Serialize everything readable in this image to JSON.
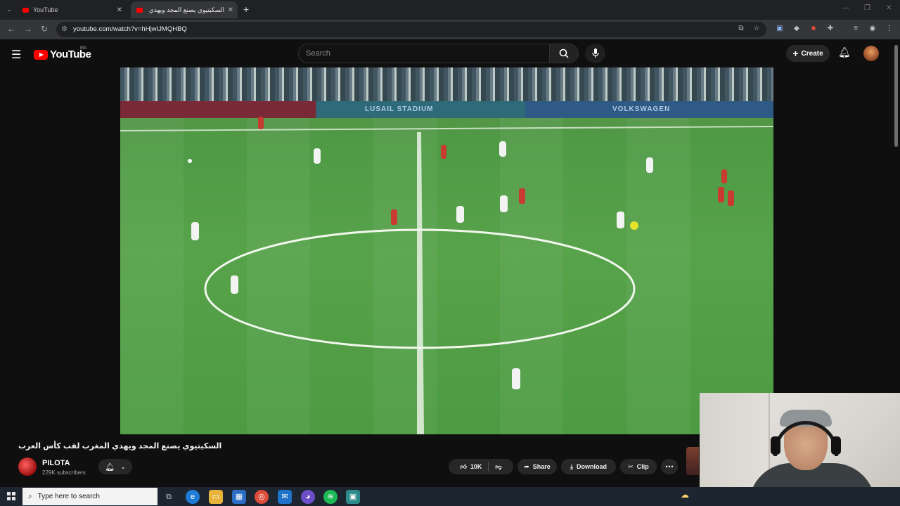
{
  "browser": {
    "tabs": [
      {
        "title": "YouTube",
        "active": false
      },
      {
        "title": "السكيتيوي يصنع المجد ويهدي ال",
        "active": true
      }
    ],
    "new_tab_label": "+",
    "url": "youtube.com/watch?v=hHjwIJMQHBQ"
  },
  "youtube": {
    "logo_text": "YouTube",
    "region": "MA",
    "search_placeholder": "Search",
    "create_label": "Create"
  },
  "video": {
    "stadium_boards": [
      "LUSAIL STADIUM",
      "VOLKSWAGEN"
    ],
    "title": "السكيتيوي يصنع المجد ويهدي المغرب لقب كأس العرب",
    "channel_name": "PILOTA",
    "subscribers": "229K subscribers",
    "likes": "10K",
    "share_label": "Share",
    "download_label": "Download",
    "clip_label": "Clip"
  },
  "taskbar": {
    "search_placeholder": "Type here to search"
  },
  "colors": {
    "brand_red": "#ff0000",
    "bg": "#0f0f0f",
    "pitch_green": "#52a047"
  }
}
